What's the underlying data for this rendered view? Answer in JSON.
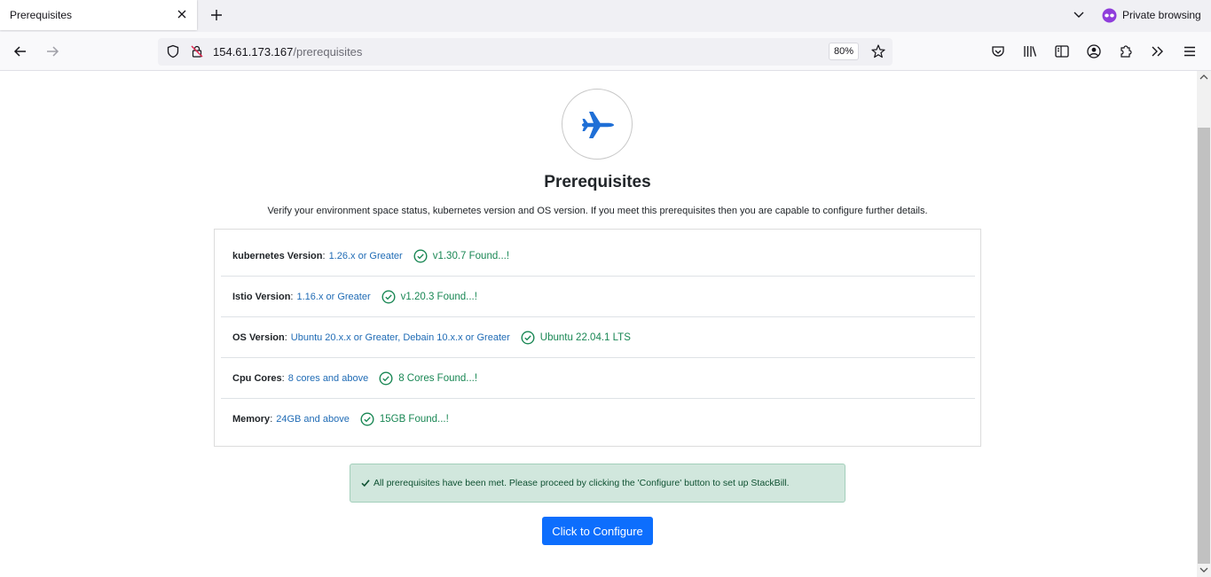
{
  "browser": {
    "tab_title": "Prerequisites",
    "private_label": "Private browsing",
    "url_host": "154.61.173.167",
    "url_path": "/prerequisites",
    "zoom": "80%"
  },
  "page": {
    "title": "Prerequisites",
    "description": "Verify your environment space status, kubernetes version and OS version. If you meet this prerequisites then you are capable to configure further details.",
    "requirements": [
      {
        "label": "kubernetes Version",
        "sep": " :",
        "need": "1.26.x or Greater",
        "found": "v1.30.7 Found...!"
      },
      {
        "label": "Istio Version",
        "sep": " :",
        "need": "1.16.x or Greater",
        "found": "v1.20.3 Found...!"
      },
      {
        "label": "OS Version",
        "sep": " :",
        "need": "Ubuntu 20.x.x or Greater, Debain 10.x.x or Greater",
        "found": "Ubuntu 22.04.1 LTS"
      },
      {
        "label": "Cpu Cores",
        "sep": " :",
        "need": "8 cores and above",
        "found": "8 Cores Found...!"
      },
      {
        "label": "Memory",
        "sep": " :",
        "need": "24GB and above",
        "found": "15GB Found...!"
      }
    ],
    "alert": "All prerequisites have been met. Please proceed by clicking the 'Configure' button to set up StackBill.",
    "configure_label": "Click to Configure"
  },
  "icons": {
    "logo": "airplane-icon",
    "check": "check-circle-icon"
  },
  "colors": {
    "primary": "#0d6efd",
    "success": "#198754",
    "link": "#1f6bb5",
    "alert_bg": "#d1e7dd"
  }
}
